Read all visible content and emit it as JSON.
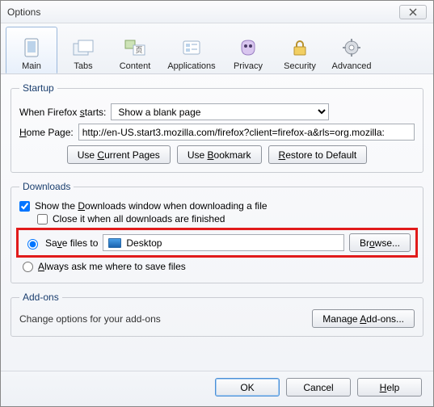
{
  "window": {
    "title": "Options"
  },
  "tabs": {
    "main": "Main",
    "tabs": "Tabs",
    "content": "Content",
    "applications": "Applications",
    "privacy": "Privacy",
    "security": "Security",
    "advanced": "Advanced"
  },
  "startup": {
    "legend": "Startup",
    "when_label_pre": "When Firefox ",
    "when_label_u": "s",
    "when_label_post": "tarts:",
    "when_value": "Show a blank page",
    "home_label_u": "H",
    "home_label_post": "ome Page:",
    "home_value": "http://en-US.start3.mozilla.com/firefox?client=firefox-a&rls=org.mozilla:",
    "use_current_pre": "Use ",
    "use_current_u": "C",
    "use_current_post": "urrent Pages",
    "use_bookmark_pre": "Use ",
    "use_bookmark_u": "B",
    "use_bookmark_post": "ookmark",
    "restore_pre": "",
    "restore_u": "R",
    "restore_post": "estore to Default"
  },
  "downloads": {
    "legend": "Downloads",
    "show_pre": "Show the ",
    "show_u": "D",
    "show_post": "ownloads window when downloading a file",
    "close_text": "Close it when all downloads are finished",
    "save_pre": "Sa",
    "save_u": "v",
    "save_post": "e files to",
    "save_path": "Desktop",
    "browse_pre": "Br",
    "browse_u": "o",
    "browse_post": "wse...",
    "ask_pre": "",
    "ask_u": "A",
    "ask_post": "lways ask me where to save files"
  },
  "addons": {
    "legend": "Add-ons",
    "desc": "Change options for your add-ons",
    "manage_pre": "Manage ",
    "manage_u": "A",
    "manage_post": "dd-ons..."
  },
  "footer": {
    "ok": "OK",
    "cancel": "Cancel",
    "help_u": "H",
    "help_post": "elp"
  }
}
